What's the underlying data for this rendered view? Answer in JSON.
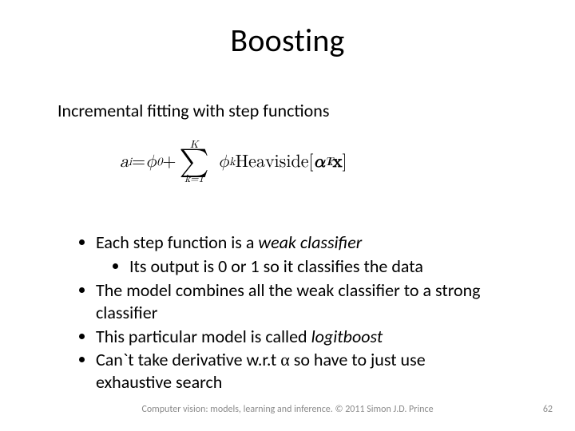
{
  "title": "Boosting",
  "subtitle": "Incremental fitting with step functions",
  "equation": {
    "lhs_var": "a",
    "lhs_sub": "i",
    "eq": " = ",
    "phi0_var": "ϕ",
    "phi0_sub": "0",
    "plus": " + ",
    "sum_top": "K",
    "sum_sym": "∑",
    "sum_bot": "k=1",
    "phik_var": "ϕ",
    "phik_sub": "k",
    "fn": "Heaviside",
    "lbr": "[",
    "alpha": "α",
    "alpha_sub": "k",
    "alpha_sup": "T",
    "x": "x",
    "rbr": "]"
  },
  "bullets": {
    "b1_a": "Each step function is a ",
    "b1_em": "weak classifier",
    "b1_sub": "Its output is 0 or 1 so it classifies the data",
    "b2": "The model combines all the weak classifier to a strong classifier",
    "b3_a": "This particular model is called ",
    "b3_em": "logitboost",
    "b4_a": "Can`t take derivative w.r.t ",
    "b4_sym": "α",
    "b4_b": " so have to just use exhaustive search"
  },
  "footer": {
    "text": "Computer vision: models, learning and inference.   © 2011 Simon J.D. Prince",
    "page": "62"
  }
}
